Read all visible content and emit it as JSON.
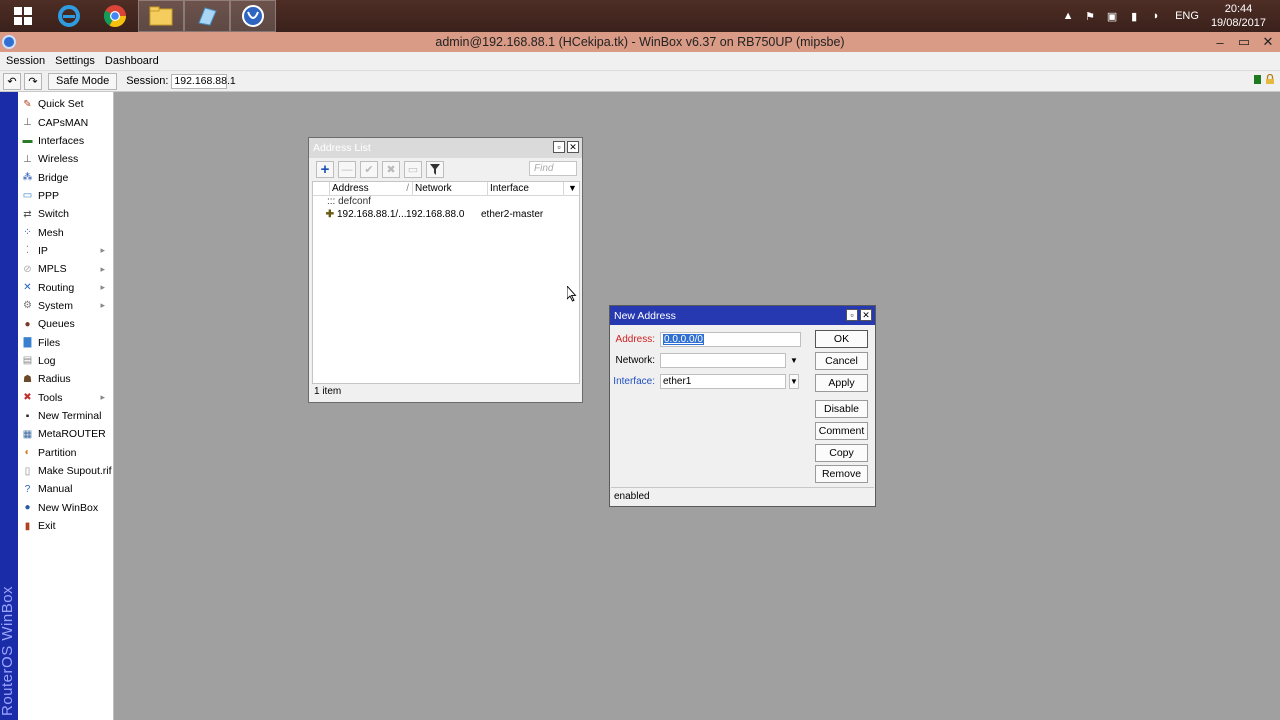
{
  "taskbar": {
    "apps": [
      "windows-start",
      "internet-explorer",
      "chrome",
      "file-explorer",
      "notepad",
      "winbox"
    ],
    "language": "ENG",
    "time": "20:44",
    "date": "19/08/2017"
  },
  "window": {
    "title": "admin@192.168.88.1 (HCekipa.tk) - WinBox v6.37 on RB750UP (mipsbe)",
    "controls": {
      "minimize": "–",
      "maximize": "▭",
      "close": "✕"
    }
  },
  "menu": {
    "items": [
      "Session",
      "Settings",
      "Dashboard"
    ]
  },
  "toolbar": {
    "undo": "↶",
    "redo": "↷",
    "safe_mode": "Safe Mode",
    "session_label": "Session:",
    "session_value": "192.168.88.1"
  },
  "brand": "RouterOS WinBox",
  "sidebar": {
    "items": [
      {
        "label": "Quick Set",
        "icon": "quickset-icon",
        "glyph": "✎",
        "color": "#b04020",
        "arrow": ""
      },
      {
        "label": "CAPsMAN",
        "icon": "capsman-icon",
        "glyph": "⊥",
        "color": "#666666",
        "arrow": ""
      },
      {
        "label": "Interfaces",
        "icon": "interfaces-icon",
        "glyph": "▬",
        "color": "#2a7a2a",
        "arrow": ""
      },
      {
        "label": "Wireless",
        "icon": "wireless-icon",
        "glyph": "⊥",
        "color": "#666666",
        "arrow": ""
      },
      {
        "label": "Bridge",
        "icon": "bridge-icon",
        "glyph": "⁂",
        "color": "#2050b0",
        "arrow": ""
      },
      {
        "label": "PPP",
        "icon": "ppp-icon",
        "glyph": "▭",
        "color": "#3a80c0",
        "arrow": ""
      },
      {
        "label": "Switch",
        "icon": "switch-icon",
        "glyph": "⇄",
        "color": "#555555",
        "arrow": ""
      },
      {
        "label": "Mesh",
        "icon": "mesh-icon",
        "glyph": "⁘",
        "color": "#2050b0",
        "arrow": ""
      },
      {
        "label": "IP",
        "icon": "ip-icon",
        "glyph": "⁚",
        "color": "#888888",
        "arrow": "▸"
      },
      {
        "label": "MPLS",
        "icon": "mpls-icon",
        "glyph": "⊘",
        "color": "#aaaaaa",
        "arrow": "▸"
      },
      {
        "label": "Routing",
        "icon": "routing-icon",
        "glyph": "✕",
        "color": "#2060c0",
        "arrow": "▸"
      },
      {
        "label": "System",
        "icon": "system-icon",
        "glyph": "⚙",
        "color": "#777777",
        "arrow": "▸"
      },
      {
        "label": "Queues",
        "icon": "queues-icon",
        "glyph": "●",
        "color": "#7a3a2a",
        "arrow": ""
      },
      {
        "label": "Files",
        "icon": "files-icon",
        "glyph": "▇",
        "color": "#3a80d0",
        "arrow": ""
      },
      {
        "label": "Log",
        "icon": "log-icon",
        "glyph": "▤",
        "color": "#888888",
        "arrow": ""
      },
      {
        "label": "Radius",
        "icon": "radius-icon",
        "glyph": "☗",
        "color": "#6a4a2a",
        "arrow": ""
      },
      {
        "label": "Tools",
        "icon": "tools-icon",
        "glyph": "✖",
        "color": "#c03030",
        "arrow": "▸"
      },
      {
        "label": "New Terminal",
        "icon": "terminal-icon",
        "glyph": "▪",
        "color": "#222222",
        "arrow": ""
      },
      {
        "label": "MetaROUTER",
        "icon": "metarouter-icon",
        "glyph": "▦",
        "color": "#3a6aa0",
        "arrow": ""
      },
      {
        "label": "Partition",
        "icon": "partition-icon",
        "glyph": "◐",
        "color": "#d08020",
        "arrow": ""
      },
      {
        "label": "Make Supout.rif",
        "icon": "supout-icon",
        "glyph": "▯",
        "color": "#888888",
        "arrow": ""
      },
      {
        "label": "Manual",
        "icon": "manual-icon",
        "glyph": "?",
        "color": "#2a60c0",
        "arrow": ""
      },
      {
        "label": "New WinBox",
        "icon": "winbox-icon",
        "glyph": "●",
        "color": "#2a5aa0",
        "arrow": ""
      },
      {
        "label": "Exit",
        "icon": "exit-icon",
        "glyph": "▮",
        "color": "#b04020",
        "arrow": ""
      }
    ]
  },
  "address_list": {
    "title": "Address List",
    "find_placeholder": "Find",
    "columns": [
      "Address",
      "Network",
      "Interface"
    ],
    "group": "::: defconf",
    "rows": [
      {
        "address": "192.168.88.1/...",
        "network": "192.168.88.0",
        "interface": "ether2-master"
      }
    ],
    "status": "1 item"
  },
  "new_address": {
    "title": "New Address",
    "fields": {
      "address_label": "Address:",
      "address_value": "0.0.0.0/0",
      "network_label": "Network:",
      "network_value": "",
      "interface_label": "Interface:",
      "interface_value": "ether1"
    },
    "buttons": {
      "ok": "OK",
      "cancel": "Cancel",
      "apply": "Apply",
      "disable": "Disable",
      "comment": "Comment",
      "copy": "Copy",
      "remove": "Remove"
    },
    "status": "enabled"
  },
  "colors": {
    "titlebar": "#d99a86",
    "active_window_title": "#2639b0",
    "brand_stripe": "#1b2ca8",
    "desktop": "#a0a0a0"
  }
}
